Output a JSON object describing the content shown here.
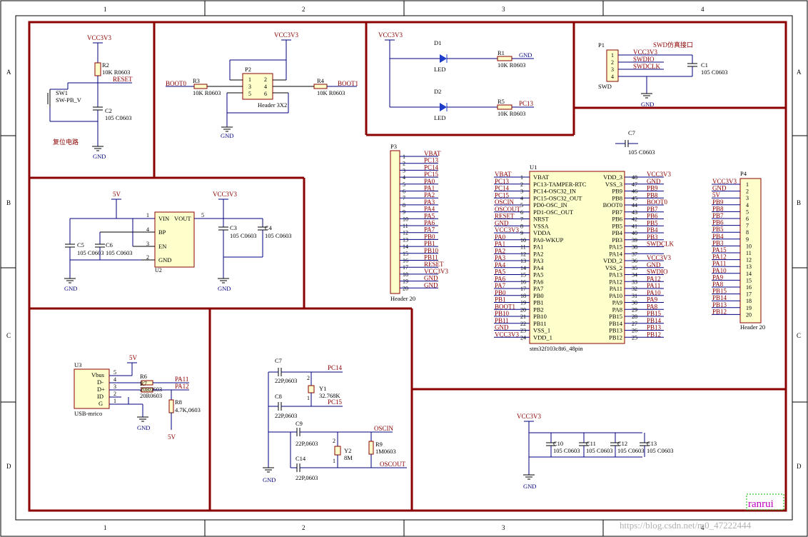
{
  "frame": {
    "columns": [
      "1",
      "2",
      "3",
      "4"
    ],
    "rows": [
      "A",
      "B",
      "C",
      "D"
    ],
    "signature": "ranrui",
    "watermark": "https://blog.csdn.net/m0_47222444"
  },
  "reset": {
    "vcc": "VCC3V3",
    "r2": "R2",
    "r2_val": "10K R0603",
    "net_reset": "RESET",
    "sw": "SW1",
    "sw_val": "SW-PB_V",
    "c2": "C2",
    "c2_val": "105 C0603",
    "gnd": "GND",
    "title": "复位电路"
  },
  "boot": {
    "vcc": "VCC3V3",
    "p2": "P2",
    "p2_pins": [
      "1",
      "2",
      "3",
      "4",
      "5",
      "6"
    ],
    "p2_val": "Header 3X2",
    "boot0": "BOOT0",
    "r3": "R3",
    "r3_val": "10K R0603",
    "r4": "R4",
    "r4_val": "10K R0603",
    "boot1": "BOOT1",
    "gnd": "GND"
  },
  "leds": {
    "vcc": "VCC3V3",
    "d1": "D1",
    "d1_val": "LED",
    "r1": "R1",
    "r1_val": "10K R0603",
    "gnd": "GND",
    "d2": "D2",
    "d2_val": "LED",
    "r5": "R5",
    "r5_val": "10K R0603",
    "pc13": "PC13"
  },
  "swd": {
    "p1": "P1",
    "title": "SWD仿真接口",
    "pins": [
      "1",
      "2",
      "3",
      "4"
    ],
    "nets": [
      "VCC3V3",
      "SWDIO",
      "SWDCLK"
    ],
    "c1": "C1",
    "c1_val": "105 C0603",
    "p1_val": "SWD",
    "gnd": "GND"
  },
  "ldo": {
    "v5": "5V",
    "vcc": "VCC3V3",
    "u2": "U2",
    "pins_left": [
      "VIN",
      "BP",
      "EN",
      "GND"
    ],
    "pin_nums_left": [
      "1",
      "4",
      "3",
      "2"
    ],
    "pin_vout": "VOUT",
    "pin_vout_num": "5",
    "c5": "C5",
    "c5_val": "105 C0603",
    "c6": "C6",
    "c6_val": "105 C0603",
    "c3": "C3",
    "c3_val": "105 C0603",
    "c4": "C4",
    "c4_val": "105 C0603",
    "gnd": "GND"
  },
  "p3": {
    "name": "P3",
    "value": "Header 20",
    "pins": [
      "1",
      "2",
      "3",
      "4",
      "5",
      "6",
      "7",
      "8",
      "9",
      "10",
      "11",
      "12",
      "13",
      "14",
      "15",
      "16",
      "17",
      "18",
      "19",
      "20"
    ],
    "nets": [
      "VBAT",
      "PC13",
      "PC14",
      "PC15",
      "PA0",
      "PA1",
      "PA2",
      "PA3",
      "PA4",
      "PA5",
      "PA6",
      "PA7",
      "PB0",
      "PB1",
      "PB10",
      "PB11",
      "RESET",
      "VCC3V3",
      "GND",
      "GND"
    ]
  },
  "mcu": {
    "name": "U1",
    "value": "stm32f103c8t6_48pin",
    "c7": "C7",
    "c7_val": "105 C0603",
    "left_nets": [
      "VBAT",
      "PC13",
      "PC14",
      "PC15",
      "OSCIN",
      "OSCOUT",
      "RESET",
      "GND",
      "VCC3V3",
      "PA0",
      "PA1",
      "PA2",
      "PA3",
      "PA4",
      "PA5",
      "PA6",
      "PA7",
      "PB0",
      "PB1",
      "BOOT1",
      "PB10",
      "PB11",
      "GND",
      "VCC3V3"
    ],
    "left_nums": [
      "1",
      "2",
      "3",
      "4",
      "5",
      "6",
      "7",
      "8",
      "9",
      "10",
      "11",
      "12",
      "13",
      "14",
      "15",
      "16",
      "17",
      "18",
      "19",
      "20",
      "21",
      "22",
      "23",
      "24"
    ],
    "left_pins": [
      "VBAT",
      "PC13-TAMPER-RTC",
      "PC14-OSC32_IN",
      "PC15-OSC32_OUT",
      "PD0-OSC_IN",
      "PD1-OSC_OUT",
      "NRST",
      "VSSA",
      "VDDA",
      "PA0-WKUP",
      "PA1",
      "PA2",
      "PA3",
      "PA4",
      "PA5",
      "PA6",
      "PA7",
      "PB0",
      "PB1",
      "PB2",
      "PB10",
      "PB11",
      "VSS_1",
      "VDD_1"
    ],
    "right_pins": [
      "VDD_3",
      "VSS_3",
      "PB9",
      "PB8",
      "BOOT0",
      "PB7",
      "PB6",
      "PB5",
      "PB4",
      "PB3",
      "PA15",
      "PA14",
      "VDD_2",
      "VSS_2",
      "PA13",
      "PA12",
      "PA11",
      "PA10",
      "PA9",
      "PA8",
      "PB15",
      "PB14",
      "PB13",
      "PB12"
    ],
    "right_nums": [
      "48",
      "47",
      "46",
      "45",
      "44",
      "43",
      "42",
      "41",
      "40",
      "39",
      "38",
      "37",
      "36",
      "35",
      "34",
      "33",
      "32",
      "31",
      "30",
      "29",
      "28",
      "27",
      "26",
      "25"
    ],
    "right_nets": [
      "VCC3V3",
      "GND",
      "PB9",
      "PB8",
      "BOOT0",
      "PB7",
      "PB6",
      "PB5",
      "PB4",
      "PB3",
      "SWDCLK",
      "",
      "VCC3V3",
      "GND",
      "SWDIO",
      "PA12",
      "PA11",
      "PA10",
      "PA9",
      "PA8",
      "PB15",
      "PB14",
      "PB13",
      "PB12"
    ]
  },
  "p4": {
    "name": "P4",
    "value": "Header 20",
    "pins": [
      "1",
      "2",
      "3",
      "4",
      "5",
      "6",
      "7",
      "8",
      "9",
      "10",
      "11",
      "12",
      "13",
      "14",
      "15",
      "16",
      "17",
      "18",
      "19",
      "20"
    ],
    "nets": [
      "VCC3V3",
      "GND",
      "5V",
      "PB9",
      "PB8",
      "PB7",
      "PB6",
      "PB5",
      "PB4",
      "PB3",
      "PA15",
      "PA12",
      "PA11",
      "PA10",
      "PA9",
      "PA8",
      "PB15",
      "PB14",
      "PB13",
      "PB12"
    ]
  },
  "usb": {
    "u3": "U3",
    "value": "USB-mrico",
    "pins": [
      "Vbus",
      "D-",
      "D+",
      "ID",
      "G"
    ],
    "pin_nums": [
      "5",
      "4",
      "3",
      "2",
      "1"
    ],
    "v5": "5V",
    "r6": "R6",
    "r6_val": "20R0603",
    "r7": "R7",
    "r7_val": "20R0603",
    "pa11": "PA11",
    "pa12": "PA12",
    "r8": "R8",
    "r8_val": "4.7K,0603",
    "v5b": "5V",
    "gnd": "GND"
  },
  "crystal": {
    "c7": "C7",
    "c7_val": "22P,0603",
    "c8": "C8",
    "c8_val": "22P,0603",
    "pc14": "PC14",
    "pc15": "PC15",
    "y1": "Y1",
    "y1_val": "32.768K",
    "c9": "C9",
    "c9_val": "22P,0603",
    "c14": "C14",
    "c14_val": "22P,0603",
    "y2": "Y2",
    "y2_val": "8M",
    "r9": "R9",
    "r9_val": "1M0603",
    "oscin": "OSCIN",
    "oscout": "OSCOUT",
    "gnd": "GND",
    "pin_nums": [
      "1",
      "2"
    ]
  },
  "decoupling": {
    "vcc": "VCC3V3",
    "caps": [
      "C10",
      "C11",
      "C12",
      "C13"
    ],
    "vals": [
      "105 C0603",
      "105 C0603",
      "105 C0603",
      "105 C0603"
    ],
    "gnd": "GND"
  }
}
